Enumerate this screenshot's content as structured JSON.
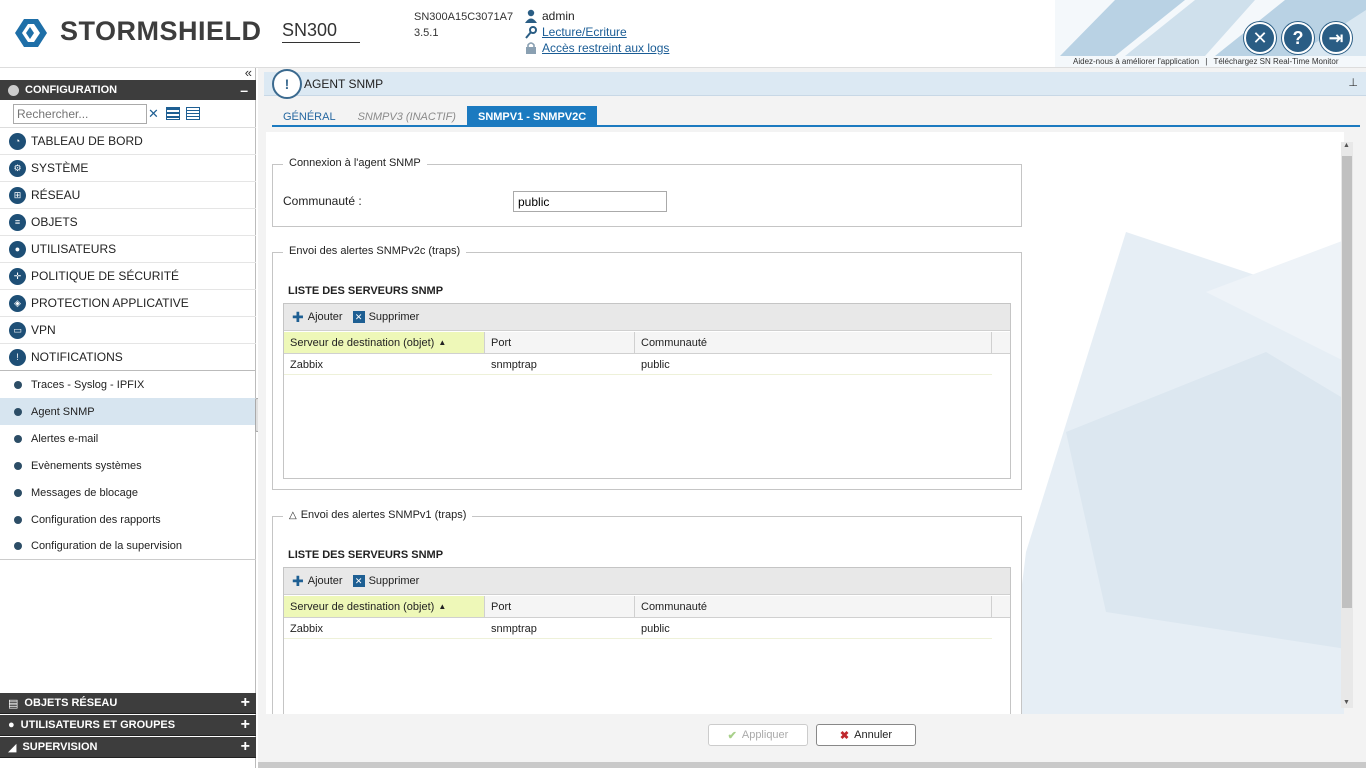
{
  "header": {
    "brand": "STORMSHIELD",
    "model": "SN300",
    "serial": "SN300A15C3071A7",
    "version": "3.5.1",
    "user": "admin",
    "access_link": "Lecture/Ecriture",
    "logs_link": "Accès restreint aux logs",
    "help_text": "Aidez-nous à améliorer l'application",
    "separator": "|",
    "download_text": "Téléchargez SN Real-Time Monitor",
    "icons": [
      "tools-icon",
      "help-icon",
      "logout-icon"
    ]
  },
  "sidebar": {
    "section_title": "CONFIGURATION",
    "search_placeholder": "Rechercher...",
    "items": [
      {
        "label": "TABLEAU DE BORD",
        "icon": "dashboard-icon"
      },
      {
        "label": "SYSTÈME",
        "icon": "system-icon"
      },
      {
        "label": "RÉSEAU",
        "icon": "network-icon"
      },
      {
        "label": "OBJETS",
        "icon": "objects-icon"
      },
      {
        "label": "UTILISATEURS",
        "icon": "users-icon"
      },
      {
        "label": "POLITIQUE DE SÉCURITÉ",
        "icon": "policy-icon"
      },
      {
        "label": "PROTECTION APPLICATIVE",
        "icon": "shield-icon"
      },
      {
        "label": "VPN",
        "icon": "vpn-icon"
      },
      {
        "label": "NOTIFICATIONS",
        "icon": "notifications-icon"
      }
    ],
    "subitems": [
      {
        "label": "Traces - Syslog - IPFIX"
      },
      {
        "label": "Agent SNMP",
        "active": true
      },
      {
        "label": "Alertes e-mail"
      },
      {
        "label": "Evènements systèmes"
      },
      {
        "label": "Messages de blocage"
      },
      {
        "label": "Configuration des rapports"
      },
      {
        "label": "Configuration de la supervision"
      }
    ],
    "bottom": [
      {
        "label": "OBJETS RÉSEAU"
      },
      {
        "label": "UTILISATEURS ET GROUPES"
      },
      {
        "label": "SUPERVISION"
      }
    ]
  },
  "main": {
    "title": "AGENT SNMP",
    "tabs": [
      {
        "label": "GÉNÉRAL",
        "state": "normal"
      },
      {
        "label": "SNMPV3 (INACTIF)",
        "state": "inactive"
      },
      {
        "label": "SNMPV1 - SNMPV2C",
        "state": "active"
      }
    ],
    "connection": {
      "legend": "Connexion à l'agent SNMP",
      "community_label": "Communauté :",
      "community_value": "public"
    },
    "traps_v2c": {
      "legend": "Envoi des alertes SNMPv2c (traps)",
      "list_title": "LISTE DES SERVEURS SNMP",
      "add_label": "Ajouter",
      "delete_label": "Supprimer",
      "columns": [
        "Serveur de destination (objet)",
        "Port",
        "Communauté"
      ],
      "rows": [
        [
          "Zabbix",
          "snmptrap",
          "public"
        ]
      ]
    },
    "traps_v1": {
      "legend": "Envoi des alertes SNMPv1 (traps)",
      "list_title": "LISTE DES SERVEURS SNMP",
      "add_label": "Ajouter",
      "delete_label": "Supprimer",
      "columns": [
        "Serveur de destination (objet)",
        "Port",
        "Communauté"
      ],
      "rows": [
        [
          "Zabbix",
          "snmptrap",
          "public"
        ]
      ]
    },
    "footer": {
      "apply_label": "Appliquer",
      "cancel_label": "Annuler"
    }
  },
  "colors": {
    "accent": "#1b7ac0",
    "dark_bar": "#3d3d3d",
    "sorted_column": "#eef8b8",
    "active_menu": "#d7e5f0"
  }
}
